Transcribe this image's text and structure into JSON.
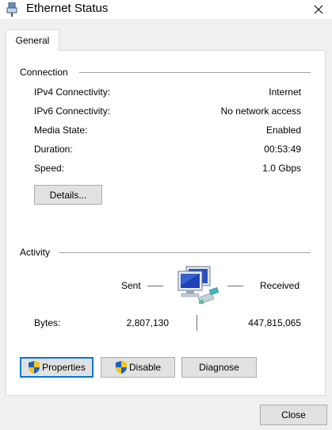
{
  "window": {
    "title": "Ethernet Status",
    "close_glyph": "✕"
  },
  "tabs": [
    {
      "label": "General"
    }
  ],
  "connection": {
    "title": "Connection",
    "rows": [
      {
        "label": "IPv4 Connectivity:",
        "value": "Internet"
      },
      {
        "label": "IPv6 Connectivity:",
        "value": "No network access"
      },
      {
        "label": "Media State:",
        "value": "Enabled"
      },
      {
        "label": "Duration:",
        "value": "00:53:49"
      },
      {
        "label": "Speed:",
        "value": "1.0 Gbps"
      }
    ],
    "details_button": "Details..."
  },
  "activity": {
    "title": "Activity",
    "sent_label": "Sent",
    "received_label": "Received",
    "bytes_label": "Bytes:",
    "bytes_sent": "2,807,130",
    "bytes_received": "447,815,065"
  },
  "buttons": {
    "properties": "Properties",
    "disable": "Disable",
    "diagnose": "Diagnose",
    "close": "Close"
  },
  "colors": {
    "focus": "#0078d7",
    "shield_blue": "#1f5fbf",
    "shield_yellow": "#f5c518"
  }
}
